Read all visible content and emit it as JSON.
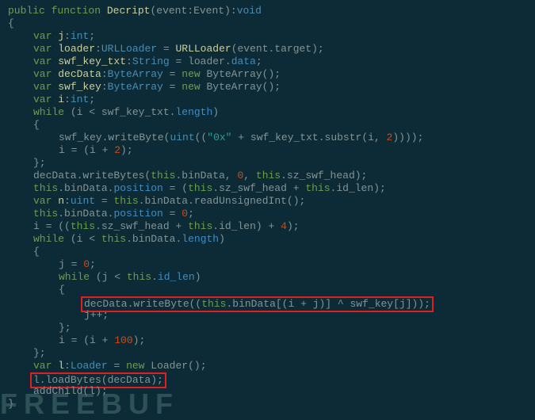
{
  "code": {
    "lines": [
      {
        "t": "SIGNATURE",
        "kw1": "public",
        "kw2": "function",
        "name": "Decript",
        "params": "(event:Event):",
        "ret": "void"
      },
      {
        "t": "BRACE_OPEN_L0"
      },
      {
        "t": "VAR",
        "indent": 1,
        "kw": "var",
        "name": "j",
        "typeSep": ":",
        "type": "int",
        "end": ";"
      },
      {
        "t": "VAR_ASSIGN",
        "indent": 1,
        "kw": "var",
        "name": "loader",
        "typeSep": ":",
        "type": "URLLoader",
        "op": " = ",
        "rhsName": "URLLoader",
        "rhsArgs": "(event.target)",
        "end": ";"
      },
      {
        "t": "VAR_ASSIGN_PROP",
        "indent": 1,
        "kw": "var",
        "name": "swf_key_txt",
        "typeSep": ":",
        "type": "String",
        "op": " = ",
        "rhs1": "loader.",
        "rhs2": "data",
        "end": ";"
      },
      {
        "t": "VAR_NEW",
        "indent": 1,
        "kw": "var",
        "name": "decData",
        "typeSep": ":",
        "type": "ByteArray",
        "op": " = ",
        "newkw": "new",
        "ctor": " ByteArray()",
        "end": ";"
      },
      {
        "t": "VAR_NEW",
        "indent": 1,
        "kw": "var",
        "name": "swf_key",
        "typeSep": ":",
        "type": "ByteArray",
        "op": " = ",
        "newkw": "new",
        "ctor": " ByteArray()",
        "end": ";"
      },
      {
        "t": "VAR",
        "indent": 1,
        "kw": "var",
        "name": "i",
        "typeSep": ":",
        "type": "int",
        "end": ";"
      },
      {
        "t": "WHILE_LEN",
        "indent": 1,
        "kw": "while",
        "open": " (",
        "lhs": "i ",
        "op": "<",
        "mid": " swf_key_txt.",
        "prop": "length",
        "close": ")"
      },
      {
        "t": "BRACE_OPEN_L1"
      },
      {
        "t": "STMT_WRITEBYTE_STR",
        "indent": 2,
        "obj": "swf_key.",
        "call": "writeByte(",
        "cast": "uint",
        "open2": "((",
        "str": "\"0x\"",
        "plus": " + swf_key_txt.",
        "m": "substr",
        "args": "(i, ",
        "num": "2",
        "close": "))))",
        "end": ";"
      },
      {
        "t": "ASSIGN_SIMPLE",
        "indent": 2,
        "lhs": "i ",
        "op": "=",
        "rhs": " (i + ",
        "num": "2",
        "close": ")",
        "end": ";"
      },
      {
        "t": "BRACE_CLOSE_L1_SEMI"
      },
      {
        "t": "STMT_WRITEBYTES",
        "indent": 1,
        "obj": "decData.",
        "call": "writeBytes(",
        "this": "this",
        "p1": ".binData, ",
        "num": "0",
        "c2": ", ",
        "this2": "this",
        "p2": ".sz_swf_head)",
        "end": ";"
      },
      {
        "t": "STMT_POSITION_EXPR",
        "indent": 1,
        "this": "this",
        "p1": ".binData.",
        "prop": "position",
        "op": " = (",
        "this2": "this",
        "p2": ".sz_swf_head + ",
        "this3": "this",
        "p3": ".id_len)",
        "end": ";"
      },
      {
        "t": "VAR_ASSIGN_CALL",
        "indent": 1,
        "kw": "var",
        "name": "n",
        "typeSep": ":",
        "type": "uint",
        "op": " = ",
        "this": "this",
        "rhs": ".binData.readUnsignedInt()",
        "end": ";"
      },
      {
        "t": "STMT_POSITION_NUM",
        "indent": 1,
        "this": "this",
        "p1": ".binData.",
        "prop": "position",
        "op": " = ",
        "num": "0",
        "end": ";"
      },
      {
        "t": "ASSIGN_EXPR",
        "indent": 1,
        "lhs": "i ",
        "op": "= ((",
        "this": "this",
        "p1": ".sz_swf_head + ",
        "this2": "this",
        "p2": ".id_len) + ",
        "num": "4",
        "close": ")",
        "end": ";"
      },
      {
        "t": "WHILE_LEN_THIS",
        "indent": 1,
        "kw": "while",
        "open": " (i ",
        "op": "<",
        "sp": " ",
        "this": "this",
        "p1": ".binData.",
        "prop": "length",
        "close": ")"
      },
      {
        "t": "BRACE_OPEN_L1"
      },
      {
        "t": "ASSIGN_SIMPLE",
        "indent": 2,
        "lhs": "j ",
        "op": "=",
        "rhs": " ",
        "num": "0",
        "close": "",
        "end": ";"
      },
      {
        "t": "WHILE_LEN_THIS",
        "indent": 2,
        "kw": "while",
        "open": " (j ",
        "op": "<",
        "sp": " ",
        "this": "this",
        "p1": ".",
        "prop": "id_len",
        "close": ")"
      },
      {
        "t": "BRACE_OPEN_L2"
      },
      {
        "t": "HIGHLIGHT1",
        "indent": 3,
        "obj": "decData.",
        "call": "writeByte((",
        "this": "this",
        "p1": ".binData[(i + j)] ^ swf_key[j]))",
        "end": ";"
      },
      {
        "t": "PLAIN",
        "indent": 3,
        "text": "j++;"
      },
      {
        "t": "BRACE_CLOSE_L2_SEMI"
      },
      {
        "t": "ASSIGN_SIMPLE",
        "indent": 2,
        "lhs": "i ",
        "op": "=",
        "rhs": " (i + ",
        "num": "100",
        "close": ")",
        "end": ";"
      },
      {
        "t": "BRACE_CLOSE_L1_SEMI"
      },
      {
        "t": "VAR_NEW",
        "indent": 1,
        "kw": "var",
        "name": "l",
        "typeSep": ":",
        "type": "Loader",
        "op": " = ",
        "newkw": "new",
        "ctor": " Loader()",
        "end": ";"
      },
      {
        "t": "HIGHLIGHT2",
        "indent": 1,
        "obj": "l.",
        "call": "loadBytes",
        "args": "(decData)",
        "end": ";"
      },
      {
        "t": "PLAIN",
        "indent": 1,
        "text": "addChild(l);"
      },
      {
        "t": "BRACE_CLOSE_L0"
      }
    ]
  },
  "watermark": "FREEBUF"
}
